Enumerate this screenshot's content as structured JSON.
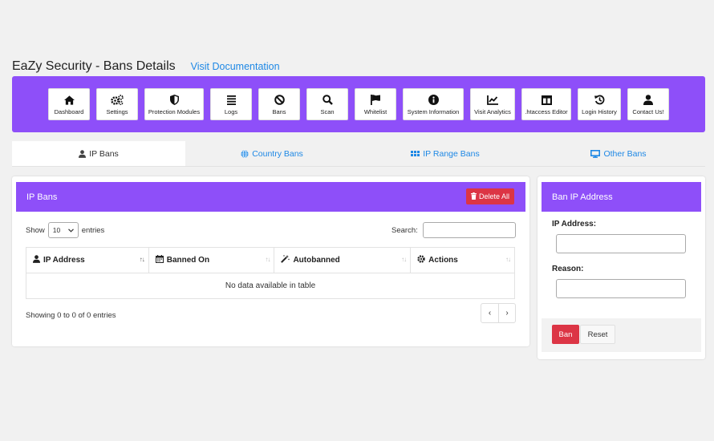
{
  "header": {
    "title": "EaZy Security - Bans Details",
    "doc_link": "Visit Documentation"
  },
  "toolbar": {
    "items": [
      {
        "label": "Dashboard",
        "icon": "home-icon"
      },
      {
        "label": "Settings",
        "icon": "gears-icon"
      },
      {
        "label": "Protection Modules",
        "icon": "shield-icon"
      },
      {
        "label": "Logs",
        "icon": "list-icon"
      },
      {
        "label": "Bans",
        "icon": "ban-icon"
      },
      {
        "label": "Scan",
        "icon": "search-icon"
      },
      {
        "label": "Whitelist",
        "icon": "flag-icon"
      },
      {
        "label": "System Information",
        "icon": "info-icon"
      },
      {
        "label": "Visit Analytics",
        "icon": "chart-icon"
      },
      {
        "label": ".htaccess Editor",
        "icon": "columns-icon"
      },
      {
        "label": "Login History",
        "icon": "history-icon"
      },
      {
        "label": "Contact Us!",
        "icon": "user-icon"
      }
    ]
  },
  "tabs": [
    {
      "label": "IP Bans",
      "icon": "user-icon",
      "active": true
    },
    {
      "label": "Country Bans",
      "icon": "globe-icon",
      "active": false
    },
    {
      "label": "IP Range Bans",
      "icon": "grip-icon",
      "active": false
    },
    {
      "label": "Other Bans",
      "icon": "desktop-icon",
      "active": false
    }
  ],
  "ip_bans": {
    "title": "IP Bans",
    "delete_all": "Delete All",
    "show": "Show",
    "entries_value": "10",
    "entries": "entries",
    "search_label": "Search:",
    "columns": [
      {
        "label": "IP Address",
        "icon": "user-icon"
      },
      {
        "label": "Banned On",
        "icon": "calendar-icon"
      },
      {
        "label": "Autobanned",
        "icon": "magic-icon"
      },
      {
        "label": "Actions",
        "icon": "gear-icon"
      }
    ],
    "empty_message": "No data available in table",
    "showing": "Showing 0 to 0 of 0 entries",
    "prev": "‹",
    "next": "›"
  },
  "ban_form": {
    "title": "Ban IP Address",
    "ip_label": "IP Address:",
    "reason_label": "Reason:",
    "ban_button": "Ban",
    "reset_button": "Reset"
  },
  "colors": {
    "accent": "#8e4ff9",
    "danger": "#dc3545",
    "link": "#1e88e5"
  }
}
